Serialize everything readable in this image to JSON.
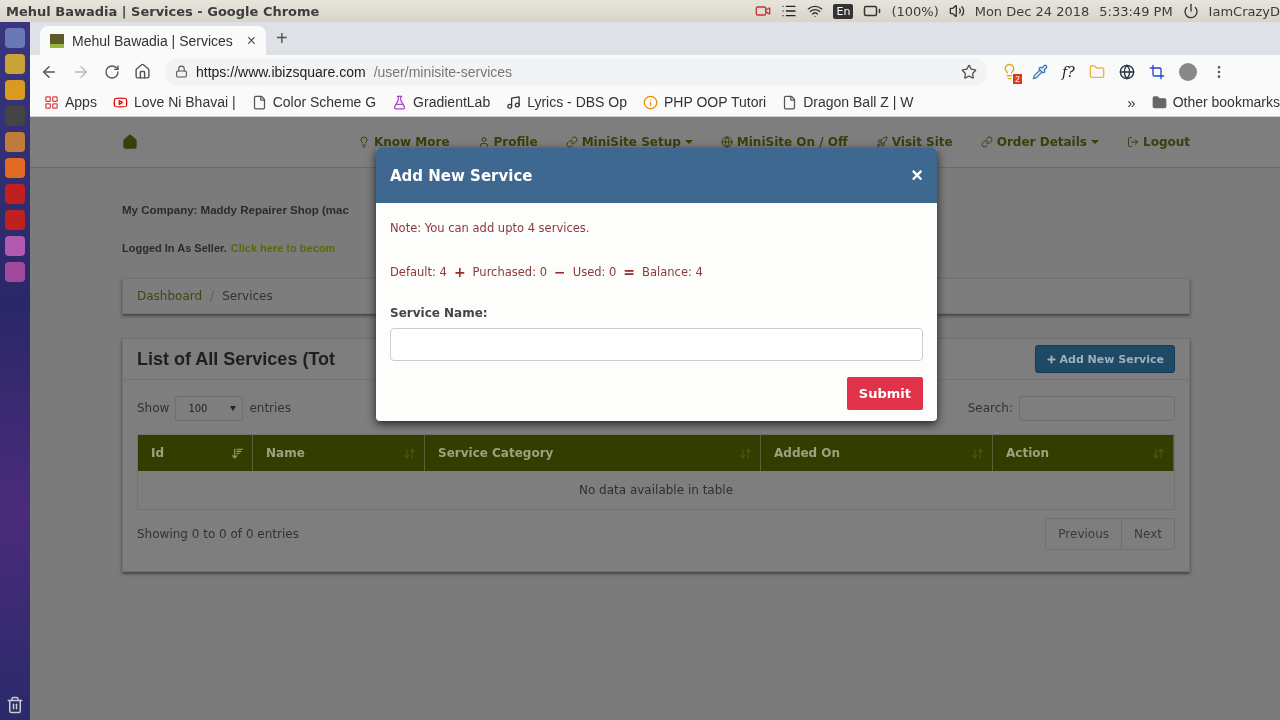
{
  "os_bar": {
    "window_title": "Mehul Bawadia | Services - Google Chrome",
    "keyboard": "En",
    "battery": "(100%)",
    "date": "Mon Dec 24 2018",
    "time": "5:33:49 PM",
    "user": "IamCrazyD"
  },
  "browser": {
    "tab_title": "Mehul Bawadia | Services",
    "tab_close": "×",
    "new_tab": "+",
    "url_host": "https://www.ibizsquare.com",
    "url_path": "/user/minisite-services",
    "extension_badge": "2",
    "extension_label": "f?",
    "bookmarks": [
      {
        "label": "Apps"
      },
      {
        "label": "Love Ni Bhavai |"
      },
      {
        "label": "Color Scheme G"
      },
      {
        "label": "GradientLab"
      },
      {
        "label": "Lyrics - DBS Op"
      },
      {
        "label": "PHP OOP Tutori"
      },
      {
        "label": "Dragon Ball Z | W"
      }
    ],
    "overflow": "»",
    "other_bookmarks": "Other bookmarks"
  },
  "nav": {
    "items": [
      {
        "label": "Know More",
        "dropdown": false
      },
      {
        "label": "Profile",
        "dropdown": false
      },
      {
        "label": "MiniSite Setup",
        "dropdown": true
      },
      {
        "label": "MiniSite On / Off",
        "dropdown": false
      },
      {
        "label": "Visit Site",
        "dropdown": false
      },
      {
        "label": "Order Details",
        "dropdown": true
      },
      {
        "label": "Logout",
        "dropdown": false
      }
    ]
  },
  "company": "My Company: Maddy Repairer Shop (mac",
  "login": {
    "text": "Logged In As Seller.",
    "link": "Click here to becom"
  },
  "breadcrumb": {
    "items": [
      "Dashboard",
      "Services"
    ],
    "separator": "/"
  },
  "panel": {
    "title": "List of All Services (Tot",
    "add_button": "Add New Service",
    "show_label": "Show",
    "page_size": "100",
    "entries_label": "entries",
    "search_label": "Search:",
    "columns": [
      {
        "label": "Id",
        "sorted": true
      },
      {
        "label": "Name",
        "sorted": false
      },
      {
        "label": "Service Category",
        "sorted": false
      },
      {
        "label": "Added On",
        "sorted": false
      },
      {
        "label": "Action",
        "sorted": false
      }
    ],
    "empty": "No data available in table",
    "info": "Showing 0 to 0 of 0 entries",
    "pagination": [
      "Previous",
      "Next"
    ]
  },
  "modal": {
    "title": "Add New Service",
    "close": "×",
    "note": "Note: You can add upto 4 services.",
    "terms": [
      {
        "label": "Default: 4",
        "op": "+"
      },
      {
        "label": "Purchased: 0",
        "op": "−"
      },
      {
        "label": "Used: 0",
        "op": "="
      },
      {
        "label": "Balance: 4"
      }
    ],
    "field_label": "Service Name:",
    "submit": "Submit"
  }
}
